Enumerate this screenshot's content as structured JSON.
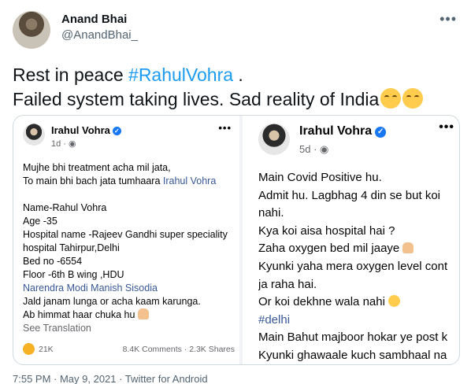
{
  "tweet": {
    "author_name": "Anand Bhai",
    "handle": "@AnandBhai_",
    "text_before_hashtag": "Rest in peace ",
    "hashtag": "#RahulVohra",
    "text_after_hashtag": " .",
    "line2": "Failed system taking lives. Sad reality of India",
    "emoji": "relieved-face-emoji",
    "timestamp": "7:55 PM · May 9, 2021 · Twitter for Android"
  },
  "fb_left": {
    "name": "Irahul Vohra",
    "meta": "1d · ",
    "lines": [
      "Mujhe bhi treatment acha mil jata,",
      "To main bhi bach jata tumhaara ",
      "",
      "Name-Rahul Vohra",
      "Age -35",
      "Hospital name -Rajeev Gandhi super speciality",
      "hospital Tahirpur,Delhi",
      "Bed no -6554",
      "Floor -6th B wing ,HDU"
    ],
    "mention_inline": "Irahul Vohra",
    "mentions": "Narendra Modi Manish Sisodia",
    "lines_after": [
      "Jald janam lunga or acha kaam karunga.",
      "Ab himmat haar chuka hu "
    ],
    "see_translation": "See Translation",
    "reactions": "21K",
    "comments_shares": "8.4K Comments · 2.3K Shares"
  },
  "fb_right": {
    "name": "Irahul Vohra",
    "meta": "5d · ",
    "lines": [
      "Main Covid Positive hu.",
      "Admit hu. Lagbhag 4 din se but koi",
      "nahi.",
      "Kya koi aisa hospital hai ?",
      "Zaha oxygen bed mil jaaye ",
      "Kyunki yaha mera oxygen level cont",
      "ja raha hai.",
      "Or koi dekhne wala nahi "
    ],
    "hashtag": "#delhi",
    "lines_after": [
      "Main Bahut majboor hokar ye post k",
      "Kyunki ghawaale kuch sambhaal na"
    ]
  },
  "colors": {
    "twitter_blue": "#1d9bf0",
    "facebook_blue": "#1877f2",
    "link_blue": "#385898"
  }
}
